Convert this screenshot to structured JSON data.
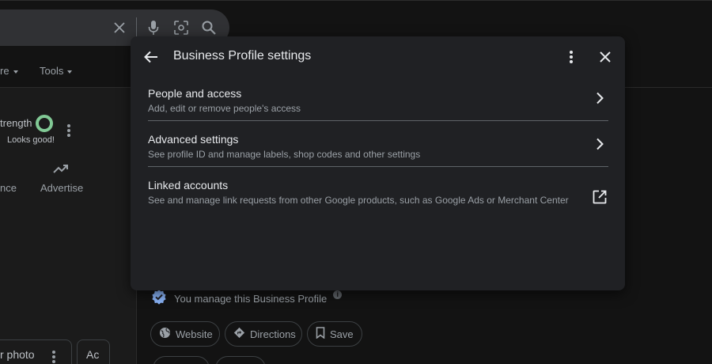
{
  "background": {
    "nav": {
      "more_label": "re",
      "tools_label": "Tools"
    },
    "profile_strength": {
      "label": "trength",
      "status": "Looks good!"
    },
    "actions": {
      "partial_label": "nce",
      "advertise_label": "Advertise"
    },
    "photo_card": {
      "label": "r photo"
    },
    "ad_card": {
      "label": "Ac"
    },
    "managed_notice": "You manage this Business Profile",
    "chips": [
      {
        "label": "Website",
        "icon": "globe-icon"
      },
      {
        "label": "Directions",
        "icon": "directions-icon"
      },
      {
        "label": "Save",
        "icon": "bookmark-icon"
      }
    ]
  },
  "dialog": {
    "title": "Business Profile settings",
    "items": [
      {
        "title": "People and access",
        "description": "Add, edit or remove people's access",
        "icon": "chevron-right-icon"
      },
      {
        "title": "Advanced settings",
        "description": "See profile ID and manage labels, shop codes and other settings",
        "icon": "chevron-right-icon"
      },
      {
        "title": "Linked accounts",
        "description": "See and manage link requests from other Google products, such as Google Ads or Merchant Center",
        "icon": "open-in-new-icon"
      }
    ]
  },
  "colors": {
    "dialog_bg": "#202124",
    "page_bg": "#131313",
    "primary_text": "#e8eaed",
    "secondary_text": "#9aa0a6",
    "strength_ring": "#81c995",
    "verified_badge": "#8ab4f8"
  }
}
